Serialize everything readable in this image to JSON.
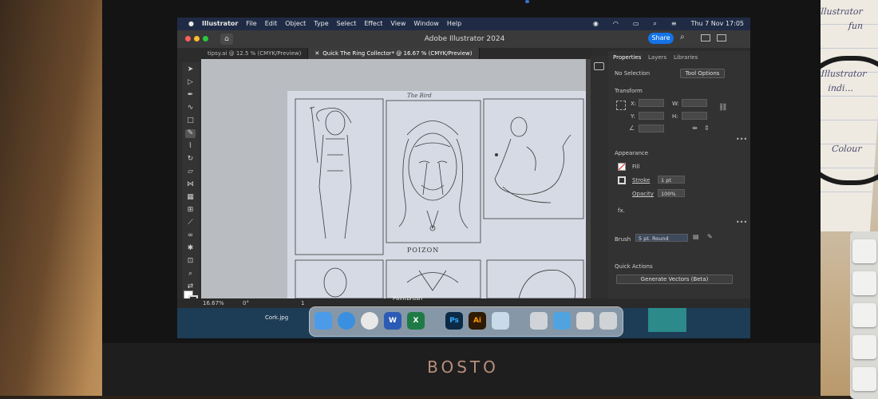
{
  "menubar": {
    "apple_icon": "apple-icon",
    "items": [
      "Illustrator",
      "File",
      "Edit",
      "Object",
      "Type",
      "Select",
      "Effect",
      "View",
      "Window",
      "Help"
    ],
    "clock": "Thu 7 Nov 17:05"
  },
  "titlebar": {
    "title": "Adobe Illustrator 2024",
    "share_label": "Share"
  },
  "tabs": [
    {
      "label": "tipsy.ai @ 12.5 % (CMYK/Preview)",
      "active": false
    },
    {
      "label": "Quick The Ring Collector* @ 16.67 % (CMYK/Preview)",
      "active": true
    }
  ],
  "artwork": {
    "top_label": "The Bird",
    "panel_caption": "POIZON"
  },
  "panel": {
    "tabs": [
      "Properties",
      "Layers",
      "Libraries"
    ],
    "selection": "No Selection",
    "tool_options_label": "Tool Options",
    "transform_title": "Transform",
    "x_label": "X:",
    "y_label": "Y:",
    "w_label": "W:",
    "h_label": "H:",
    "appearance_title": "Appearance",
    "fill_label": "Fill",
    "stroke_label": "Stroke",
    "stroke_value": "1 pt",
    "opacity_label": "Opacity",
    "opacity_value": "100%",
    "fx_label": "fx.",
    "brush_label": "Brush",
    "brush_value": "5 pt. Round",
    "quick_actions_title": "Quick Actions",
    "generate_label": "Generate Vectors (Beta)"
  },
  "statusbar": {
    "zoom": "16.67%",
    "rotation": "0°",
    "artboard": "1",
    "tool": "Paintbrush"
  },
  "desktop": {
    "file_label": "Cork.jpg"
  },
  "dock": {
    "apps": [
      {
        "name": "finder-icon",
        "glyph": "",
        "color": "#4b9be8"
      },
      {
        "name": "safari-icon",
        "glyph": "",
        "color": "#3a8fe0"
      },
      {
        "name": "chrome-icon",
        "glyph": "",
        "color": "#e8e8e8"
      },
      {
        "name": "word-icon",
        "glyph": "W",
        "color": "#2b5bb5"
      },
      {
        "name": "excel-icon",
        "glyph": "X",
        "color": "#1f7b45"
      },
      {
        "name": "photoshop-icon",
        "glyph": "Ps",
        "color": "#0b2a45"
      },
      {
        "name": "illustrator-icon",
        "glyph": "Ai",
        "color": "#2e1a05"
      },
      {
        "name": "preview-icon",
        "glyph": "",
        "color": "#c8dbe8"
      },
      {
        "name": "document-icon",
        "glyph": "",
        "color": "#d0d4d8"
      },
      {
        "name": "folder-icon",
        "glyph": "",
        "color": "#4fa4e0"
      },
      {
        "name": "screenshot-icon",
        "glyph": "",
        "color": "#d8d8d8"
      },
      {
        "name": "trash-icon",
        "glyph": "",
        "color": "#cfd3d6"
      }
    ]
  },
  "monitor": {
    "brand": "BOSTO"
  },
  "notebook": {
    "lines": [
      "Illustrator",
      "fun",
      "Illustrator",
      "indi...",
      "Colour"
    ]
  }
}
